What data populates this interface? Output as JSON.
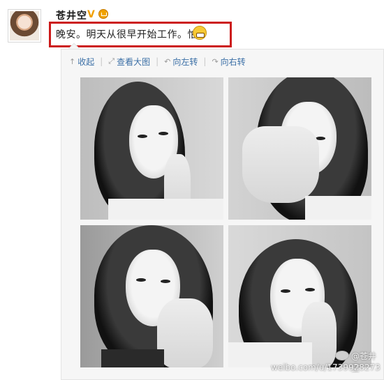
{
  "author": {
    "name": "苍井空",
    "verified_mark": "V"
  },
  "post": {
    "text": "晚安。明天从很早开始工作。怕"
  },
  "toolbar": {
    "collapse": "收起",
    "view_large": "查看大图",
    "rotate_left": "向左转",
    "rotate_right": "向右转"
  },
  "icons": {
    "collapse": "↑",
    "view_large": "⤢",
    "rotate_left": "↶",
    "rotate_right": "↷"
  },
  "watermark": {
    "name": "@苍井空",
    "url": "weibo.com/u/1739928273"
  },
  "colors": {
    "highlight": "#cc1a1a",
    "link": "#3b6fa6"
  }
}
